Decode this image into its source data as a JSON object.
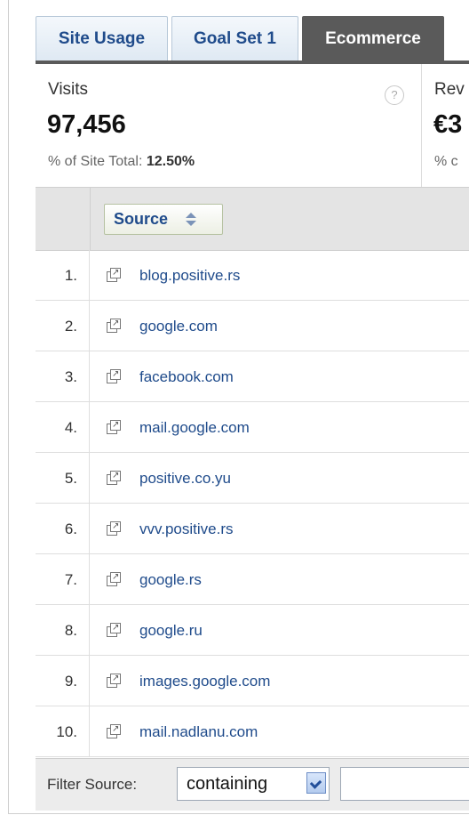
{
  "tabs": [
    "Site Usage",
    "Goal Set 1",
    "Ecommerce"
  ],
  "metrics": {
    "visits": {
      "label": "Visits",
      "value": "97,456",
      "sub_prefix": "% of Site Total: ",
      "sub_value": "12.50%",
      "help": "?"
    },
    "revenue": {
      "label": "Rev",
      "value": "€3",
      "sub": "% c"
    }
  },
  "table": {
    "column": "Source",
    "rows": [
      {
        "n": "1.",
        "source": "blog.positive.rs"
      },
      {
        "n": "2.",
        "source": "google.com"
      },
      {
        "n": "3.",
        "source": "facebook.com"
      },
      {
        "n": "4.",
        "source": "mail.google.com"
      },
      {
        "n": "5.",
        "source": "positive.co.yu"
      },
      {
        "n": "6.",
        "source": "vvv.positive.rs"
      },
      {
        "n": "7.",
        "source": "google.rs"
      },
      {
        "n": "8.",
        "source": "google.ru"
      },
      {
        "n": "9.",
        "source": "images.google.com"
      },
      {
        "n": "10.",
        "source": "mail.nadlanu.com"
      }
    ]
  },
  "filter": {
    "label": "Filter Source:",
    "mode": "containing",
    "query": ""
  }
}
